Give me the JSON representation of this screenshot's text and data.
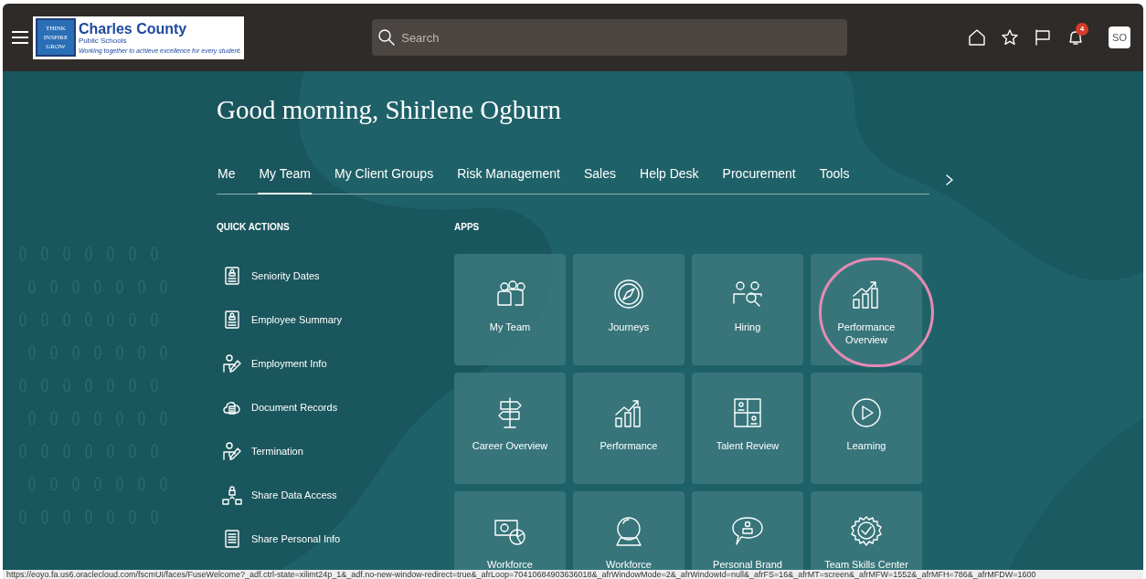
{
  "header": {
    "logo": {
      "title": "Charles County",
      "subtitle": "Public Schools",
      "tagline": "Working together to achieve excellence for every student.",
      "badge_lines": [
        "THINK",
        "INSPIRE",
        "GROW"
      ]
    },
    "search": {
      "placeholder": "Search"
    },
    "notifications": {
      "count": "4"
    },
    "user_initials": "SO"
  },
  "greeting": "Good morning, Shirlene Ogburn",
  "tabs": [
    {
      "label": "Me",
      "selected": false
    },
    {
      "label": "My Team",
      "selected": true
    },
    {
      "label": "My Client Groups",
      "selected": false
    },
    {
      "label": "Risk Management",
      "selected": false
    },
    {
      "label": "Sales",
      "selected": false
    },
    {
      "label": "Help Desk",
      "selected": false
    },
    {
      "label": "Procurement",
      "selected": false
    },
    {
      "label": "Tools",
      "selected": false
    }
  ],
  "quick_actions": {
    "heading": "QUICK ACTIONS",
    "items": [
      "Seniority Dates",
      "Employee Summary",
      "Employment Info",
      "Document Records",
      "Termination",
      "Share Data Access",
      "Share Personal Info"
    ]
  },
  "apps": {
    "heading": "APPS",
    "items": [
      {
        "label": "My Team",
        "highlighted": false
      },
      {
        "label": "Journeys",
        "highlighted": false
      },
      {
        "label": "Hiring",
        "highlighted": false
      },
      {
        "label": "Performance Overview",
        "highlighted": true
      },
      {
        "label": "Career Overview",
        "highlighted": false
      },
      {
        "label": "Performance",
        "highlighted": false
      },
      {
        "label": "Talent Review",
        "highlighted": false
      },
      {
        "label": "Learning",
        "highlighted": false
      },
      {
        "label": "Workforce",
        "highlighted": false
      },
      {
        "label": "Workforce",
        "highlighted": false
      },
      {
        "label": "Personal Brand",
        "highlighted": false
      },
      {
        "label": "Team Skills Center",
        "highlighted": false
      }
    ]
  },
  "status_bar": {
    "url": "https://eoyo.fa.us6.oraclecloud.com/fscmUI/faces/FuseWelcome?_adf.ctrl-state=xilimt24p_1&_adf.no-new-window-redirect=true&_afrLoop=70410684903636018&_afrWindowMode=2&_afrWindowId=null&_afrFS=16&_afrMT=screen&_afrMFW=1552&_afrMFH=786&_afrMFDW=1600"
  }
}
